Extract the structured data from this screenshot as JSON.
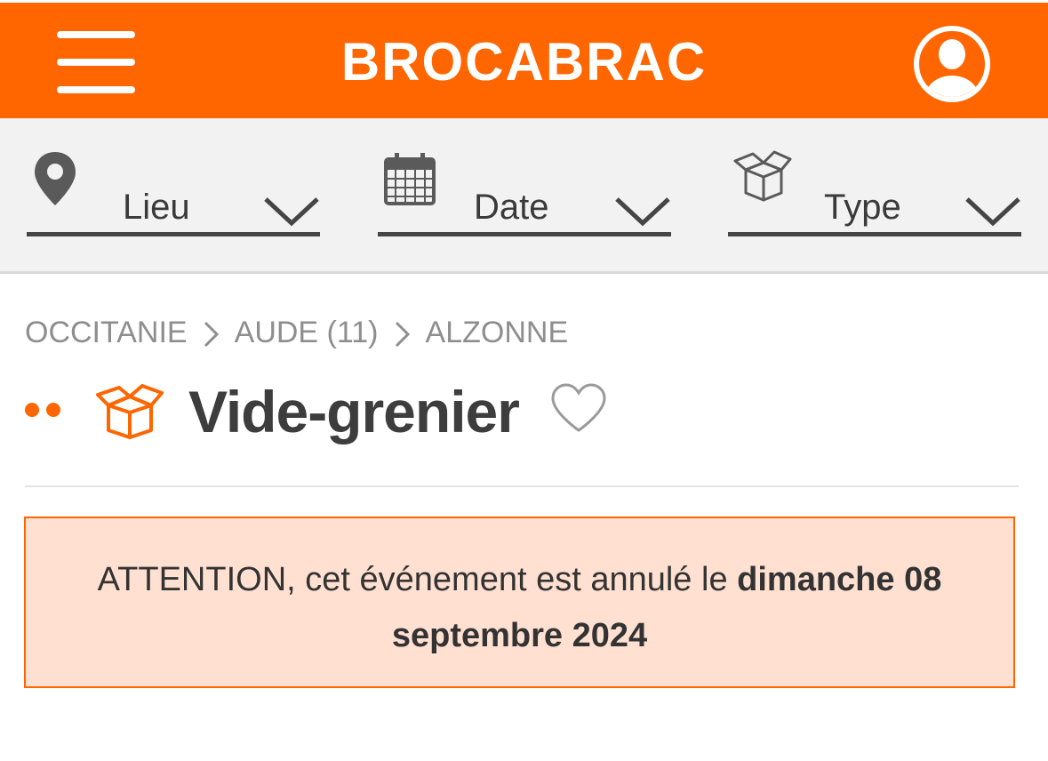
{
  "header": {
    "logo": "BROCABRAC",
    "menu_icon": "hamburger-menu-icon",
    "user_icon": "user-account-icon",
    "brand_color": "#ff6600"
  },
  "filters": [
    {
      "label": "Lieu",
      "icon": "location-pin-icon"
    },
    {
      "label": "Date",
      "icon": "calendar-icon"
    },
    {
      "label": "Type",
      "icon": "box-icon"
    }
  ],
  "breadcrumb": [
    "OCCITANIE",
    "AUDE (11)",
    "ALZONNE"
  ],
  "event": {
    "title": "Vide-grenier",
    "type_icon": "open-box-icon",
    "favorite_icon": "heart-outline-icon"
  },
  "alert": {
    "text": "ATTENTION, cet événement est annulé le ",
    "date": "dimanche 08 septembre 2024",
    "background": "#ffe0d1",
    "border": "#ff6600"
  }
}
